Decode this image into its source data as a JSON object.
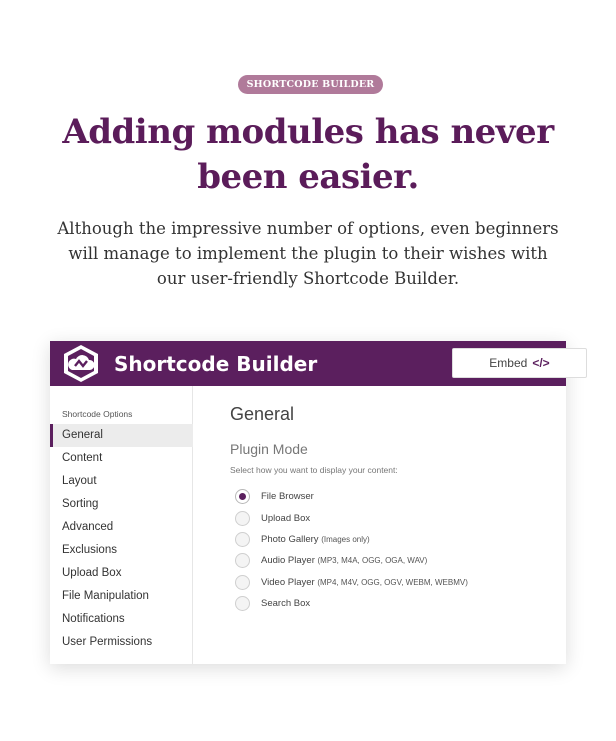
{
  "badge": "SHORTCODE BUILDER",
  "headline": {
    "line1": "Adding modules has never",
    "line2": "been easier."
  },
  "lede": {
    "line1": "Although the impressive number of options, even beginners",
    "line2": "will manage to implement the plugin to their wishes with",
    "line3": "our user-friendly Shortcode Builder."
  },
  "card": {
    "title": "Shortcode Builder",
    "embed_label": "Embed",
    "embed_icon": "code-icon",
    "embed_icon_glyph": "</>",
    "header_color": "#5b1f5e"
  },
  "sidebar": {
    "heading": "Shortcode Options",
    "items": [
      {
        "label": "General",
        "active": true
      },
      {
        "label": "Content"
      },
      {
        "label": "Layout"
      },
      {
        "label": "Sorting"
      },
      {
        "label": "Advanced"
      },
      {
        "label": "Exclusions"
      },
      {
        "label": "Upload Box"
      },
      {
        "label": "File Manipulation"
      },
      {
        "label": "Notifications"
      },
      {
        "label": "User Permissions"
      }
    ]
  },
  "main": {
    "title": "General",
    "subtitle": "Plugin Mode",
    "helper": "Select how you want to display your content:",
    "options": [
      {
        "label": "File Browser",
        "note": "",
        "checked": true
      },
      {
        "label": "Upload Box",
        "note": ""
      },
      {
        "label": "Photo Gallery",
        "note": "(Images only)"
      },
      {
        "label": "Audio Player",
        "note": "(MP3, M4A, OGG, OGA, WAV)"
      },
      {
        "label": "Video Player",
        "note": "(MP4, M4V, OGG, OGV, WEBM, WEBMV)"
      },
      {
        "label": "Search Box",
        "note": ""
      }
    ]
  }
}
